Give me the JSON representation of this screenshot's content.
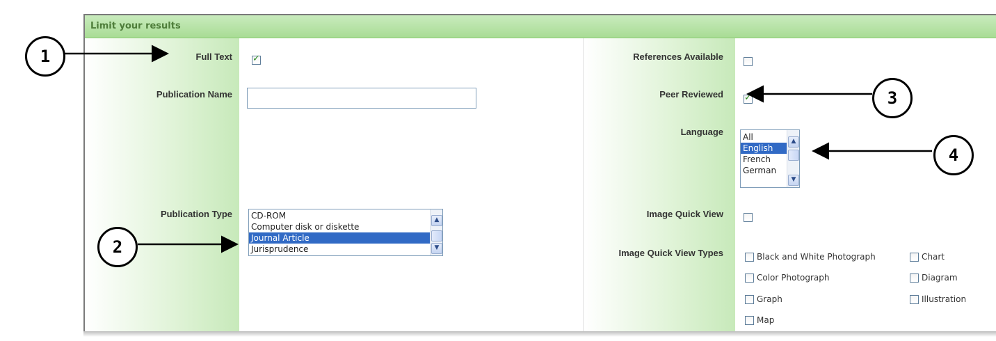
{
  "panel": {
    "title": "Limit your results"
  },
  "left": {
    "full_text_label": "Full Text",
    "full_text_checked": true,
    "publication_name_label": "Publication Name",
    "publication_name_value": "",
    "publication_type_label": "Publication Type",
    "publication_type_options": [
      "CD-ROM",
      "Computer disk or diskette",
      "Journal Article",
      "Jurisprudence"
    ],
    "publication_type_selected": "Journal Article"
  },
  "right": {
    "references_label": "References Available",
    "references_checked": false,
    "peer_reviewed_label": "Peer Reviewed",
    "peer_reviewed_checked": true,
    "language_label": "Language",
    "language_options": [
      "All",
      "English",
      "French",
      "German"
    ],
    "language_selected": "English",
    "image_quick_view_label": "Image Quick View",
    "image_quick_view_checked": false,
    "image_quick_view_types_label": "Image Quick View Types",
    "image_types": [
      "Black and White Photograph",
      "Chart",
      "Color Photograph",
      "Diagram",
      "Graph",
      "Illustration",
      "Map"
    ]
  },
  "callouts": [
    "1",
    "2",
    "3",
    "4"
  ],
  "colors": {
    "header_green": "#a9dc95",
    "selection_blue": "#316ac5",
    "label_green": "#4e7d3a"
  }
}
